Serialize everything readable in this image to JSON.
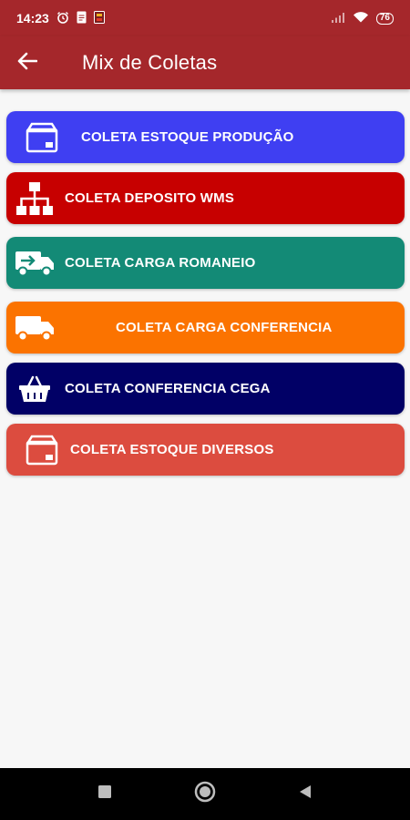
{
  "status_bar": {
    "time": "14:23",
    "battery": "76"
  },
  "app_bar": {
    "title": "Mix de Coletas"
  },
  "menu": {
    "items": [
      {
        "label": "COLETA ESTOQUE PRODUÇÃO",
        "color": "#3f3ff2",
        "icon": "box-icon"
      },
      {
        "label": "COLETA DEPOSITO WMS",
        "color": "#c70000",
        "icon": "sitemap-icon"
      },
      {
        "label": "COLETA CARGA ROMANEIO",
        "color": "#138a76",
        "icon": "truck-moving-icon"
      },
      {
        "label": "COLETA CARGA CONFERENCIA",
        "color": "#fb7300",
        "icon": "truck-icon"
      },
      {
        "label": "COLETA CONFERENCIA CEGA",
        "color": "#010066",
        "icon": "basket-icon"
      },
      {
        "label": "COLETA ESTOQUE DIVERSOS",
        "color": "#dc4c3f",
        "icon": "box-icon"
      }
    ]
  },
  "colors": {
    "app_bar": "#a5272b",
    "background": "#f7f7f7"
  }
}
